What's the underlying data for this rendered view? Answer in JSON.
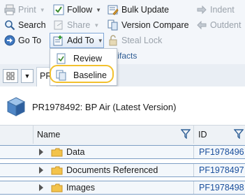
{
  "toolbar": {
    "print": "Print",
    "follow": "Follow",
    "bulk_update": "Bulk Update",
    "indent": "Indent",
    "search": "Search",
    "share": "Share",
    "version_compare": "Version Compare",
    "outdent": "Outdent",
    "go_to": "Go To",
    "add_to": "Add To",
    "steal_lock": "Steal Lock",
    "group_label_partial": "tifacts"
  },
  "add_to_menu": {
    "items": [
      {
        "label": "Review"
      },
      {
        "label": "Baseline"
      }
    ]
  },
  "tabs": {
    "partial_tab": "PR"
  },
  "object": {
    "title": "PR1978492: BP Air (Latest Version)"
  },
  "grid": {
    "columns": [
      "Name",
      "ID"
    ],
    "rows": [
      {
        "name": "Data",
        "id": "PF1978496"
      },
      {
        "name": "Documents Referenced",
        "id": "PF1978497"
      },
      {
        "name": "Images",
        "id": "PF1978498"
      }
    ]
  },
  "colors": {
    "highlight": "#f2c12e",
    "link_id": "#1a4f9c",
    "row_border": "#7e9fc5"
  }
}
